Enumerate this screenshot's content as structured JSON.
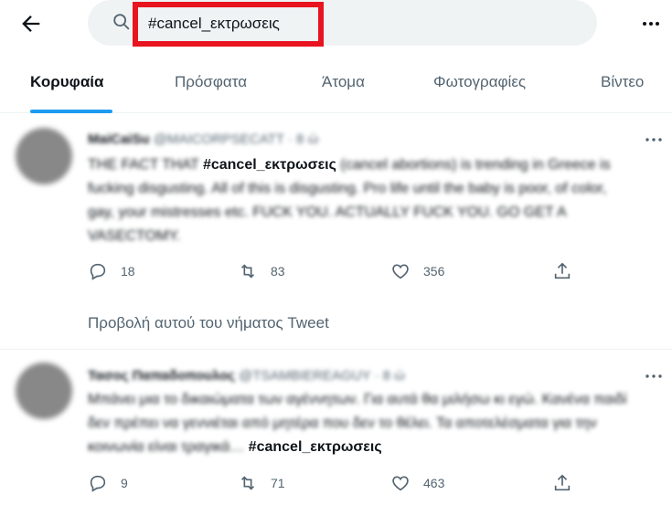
{
  "search": {
    "query": "#cancel_εκτρωσεις"
  },
  "tabs": [
    {
      "label": "Κορυφαία"
    },
    {
      "label": "Πρόσφατα"
    },
    {
      "label": "Άτομα"
    },
    {
      "label": "Φωτογραφίες"
    },
    {
      "label": "Βίντεο"
    }
  ],
  "tweets": [
    {
      "name": "MaiCaiSu",
      "handle": "@MAICORPSECATT",
      "time": "· 8 ώ",
      "text_before": "THE FACT THAT",
      "hashtag": "#cancel_εκτρωσεις",
      "text_after": "(cancel abortions) is trending in Greece is fucking disgusting. All of this is disgusting. Pro life until the baby is poor, of color, gay, your mistresses etc. FUCK YOU. ACTUALLY FUCK YOU. GO GET A VASECTOMY.",
      "replies": "18",
      "retweets": "83",
      "likes": "356",
      "thread_link": "Προβολή αυτού του νήματος Tweet"
    },
    {
      "name": "Τασος Παπαδοπουλος",
      "handle": "@TSAMBIEREAGUY",
      "time": "· 8 ώ",
      "text_before": "Μπάνει μια το δικαιώματα των αγέννητων. Για αυτά θα μιλήσω κι εγώ. Κανένα παιδί δεν πρέπει να γεννιέται από μητέρα που δεν το θέλει. Τα αποτελέσματα για την κοινωνία είναι τραγικά…",
      "hashtag": "#cancel_εκτρωσεις",
      "text_after": "",
      "replies": "9",
      "retweets": "71",
      "likes": "463"
    }
  ],
  "colors": {
    "accent": "#1d9bf0",
    "highlight": "#e8141f",
    "muted": "#536471",
    "text": "#0f1419"
  }
}
